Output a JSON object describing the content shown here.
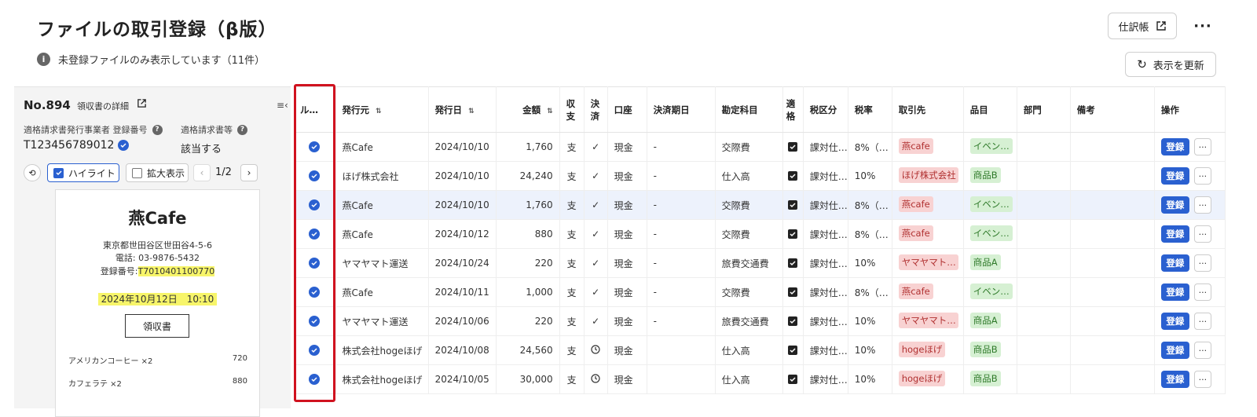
{
  "title": "ファイルの取引登録（β版）",
  "info_text": "未登録ファイルのみ表示しています（11件）",
  "journal_label": "仕訳帳",
  "refresh_label": "表示を更新",
  "left_panel": {
    "no": "No.894",
    "detail_label": "領収書の詳細",
    "reg_label": "適格請求書発行事業者 登録番号",
    "reg_value": "T123456789012",
    "inv_label": "適格請求書等",
    "inv_value": "該当する",
    "highlight_label": "ハイライト",
    "zoom_label": "拡大表示",
    "page": "1/2"
  },
  "receipt": {
    "shop": "燕Cafe",
    "address": "東京都世田谷区世田谷4-5-6",
    "phone": "電話: 03-9876-5432",
    "reg_prefix": "登録番号:",
    "reg_no": "T7010401100770",
    "datetime": "2024年10月12日　10:10",
    "doc_title": "領収書",
    "items": [
      {
        "name": "アメリカンコーヒー ×2",
        "price": "720"
      },
      {
        "name": "カフェラテ ×2",
        "price": "880"
      }
    ]
  },
  "table": {
    "headers": [
      "ル…",
      "発行元",
      "発行日",
      "金額",
      "収支",
      "決済",
      "口座",
      "決済期日",
      "勘定科目",
      "適格",
      "税区分",
      "税率",
      "取引先",
      "品目",
      "部門",
      "備考",
      "操作"
    ],
    "rows": [
      {
        "issuer": "燕Cafe",
        "date": "2024/10/10",
        "amount": "1,760",
        "type": "支",
        "settle": "✓",
        "account": "現金",
        "due": "-",
        "subject": "交際費",
        "tax_div": "課対仕…",
        "rate": "8%（…",
        "partner": "燕cafe",
        "item": "イベン…",
        "action": "登録"
      },
      {
        "issuer": "ほげ株式会社",
        "date": "2024/10/10",
        "amount": "24,240",
        "type": "支",
        "settle": "✓",
        "account": "現金",
        "due": "-",
        "subject": "仕入高",
        "tax_div": "課対仕…",
        "rate": "10%",
        "partner": "ほげ株式会社",
        "item": "商品B",
        "action": "登録"
      },
      {
        "issuer": "燕Cafe",
        "date": "2024/10/10",
        "amount": "1,760",
        "type": "支",
        "settle": "✓",
        "account": "現金",
        "due": "-",
        "subject": "交際費",
        "tax_div": "課対仕…",
        "rate": "8%（…",
        "partner": "燕cafe",
        "item": "イベン…",
        "action": "登録"
      },
      {
        "issuer": "燕Cafe",
        "date": "2024/10/12",
        "amount": "880",
        "type": "支",
        "settle": "✓",
        "account": "現金",
        "due": "-",
        "subject": "交際費",
        "tax_div": "課対仕…",
        "rate": "8%（…",
        "partner": "燕cafe",
        "item": "イベン…",
        "action": "登録"
      },
      {
        "issuer": "ヤマヤマト運送",
        "date": "2024/10/24",
        "amount": "220",
        "type": "支",
        "settle": "✓",
        "account": "現金",
        "due": "-",
        "subject": "旅費交通費",
        "tax_div": "課対仕…",
        "rate": "10%",
        "partner": "ヤマヤマト…",
        "item": "商品A",
        "action": "登録"
      },
      {
        "issuer": "燕Cafe",
        "date": "2024/10/11",
        "amount": "1,000",
        "type": "支",
        "settle": "✓",
        "account": "現金",
        "due": "-",
        "subject": "交際費",
        "tax_div": "課対仕…",
        "rate": "8%（…",
        "partner": "燕cafe",
        "item": "イベン…",
        "action": "登録"
      },
      {
        "issuer": "ヤマヤマト運送",
        "date": "2024/10/06",
        "amount": "220",
        "type": "支",
        "settle": "✓",
        "account": "現金",
        "due": "-",
        "subject": "旅費交通費",
        "tax_div": "課対仕…",
        "rate": "10%",
        "partner": "ヤマヤマト…",
        "item": "商品A",
        "action": "登録"
      },
      {
        "issuer": "株式会社hogeほげ",
        "date": "2024/10/08",
        "amount": "24,560",
        "type": "支",
        "settle": "clock",
        "account": "現金",
        "due": "",
        "subject": "仕入高",
        "tax_div": "課対仕…",
        "rate": "10%",
        "partner": "hogeほげ",
        "item": "商品B",
        "action": "登録"
      },
      {
        "issuer": "株式会社hogeほげ",
        "date": "2024/10/05",
        "amount": "30,000",
        "type": "支",
        "settle": "clock",
        "account": "現金",
        "due": "",
        "subject": "仕入高",
        "tax_div": "課対仕…",
        "rate": "10%",
        "partner": "hogeほげ",
        "item": "商品B",
        "action": "登録"
      }
    ],
    "selected_row": 2
  },
  "colors": {
    "accent": "#2a60d0",
    "highlight_box": "#d0121f",
    "payment": "#d22222"
  }
}
